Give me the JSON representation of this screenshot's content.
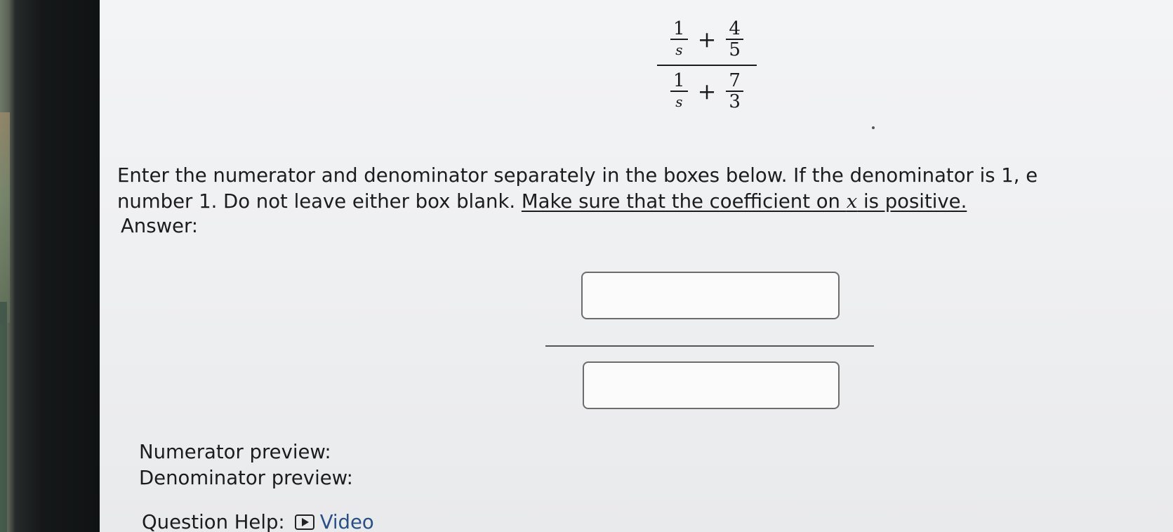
{
  "expression": {
    "top_left": {
      "num": "1",
      "den": "s"
    },
    "top_op": "+",
    "top_right": {
      "num": "4",
      "den": "5"
    },
    "bottom_left": {
      "num": "1",
      "den": "s"
    },
    "bottom_op": "+",
    "bottom_right": {
      "num": "7",
      "den": "3"
    }
  },
  "instructions": {
    "line1": "Enter the numerator and denominator separately in the boxes below. If the denominator is 1, e",
    "line2_plain": "number 1. Do not leave either box blank. ",
    "line2_underline_a": "Make sure that the coefficient on ",
    "line2_var": "x",
    "line2_underline_b": " is positive."
  },
  "answer": {
    "label": "Answer:",
    "numerator_value": "",
    "denominator_value": ""
  },
  "preview": {
    "numerator_label": "Numerator preview:",
    "denominator_label": "Denominator preview:"
  },
  "help": {
    "label": "Question Help:",
    "video_label": "Video",
    "video_icon": "play-icon"
  }
}
